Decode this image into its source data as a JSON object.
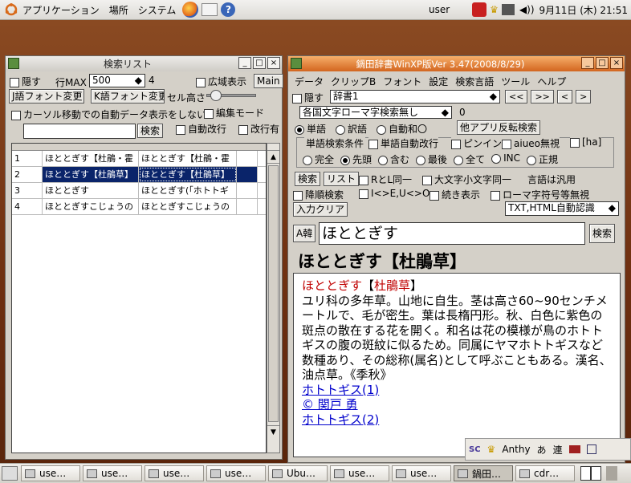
{
  "top_panel": {
    "menus": [
      "アプリケーション",
      "場所",
      "システム"
    ],
    "user": "user",
    "datetime": "9月11日 (木) 21:51"
  },
  "search_list": {
    "title": "検索リスト",
    "hide_label": "隠す",
    "row_max_label": "行MAX",
    "row_max_value": "500",
    "count": "4",
    "wide_display_label": "広域表示",
    "main_button": "Main",
    "font_btn1": "J語フォント変更",
    "font_btn2": "K語フォント変更",
    "cell_height_label": "セル高さ",
    "cursor_auto_label": "カーソル移動での自動データ表示をしない",
    "edit_mode_label": "編集モード",
    "search_button": "検索",
    "auto_newline_label": "自動改行",
    "newline_label": "改行有",
    "rows": [
      {
        "num": "1",
        "c1": "ほととぎす【杜鵑・霍",
        "c2": "ほととぎす【杜鵑・霍"
      },
      {
        "num": "2",
        "c1": "ほととぎす【杜鵑草】",
        "c2": "ほととぎす【杜鵑草】"
      },
      {
        "num": "3",
        "c1": "ほととぎす",
        "c2": "ほととぎす(「ホトトギ"
      },
      {
        "num": "4",
        "c1": "ほととぎすこじょうの",
        "c2": "ほととぎすこじょうの"
      }
    ]
  },
  "main_window": {
    "title": "鍋田辞書WinXP版Ver 3.47(2008/8/29)",
    "menu": [
      "データ",
      "クリップB",
      "フォント",
      "設定",
      "検索言語",
      "ツール",
      "ヘルプ"
    ],
    "hide_label": "隠す",
    "dict_value": "辞書1",
    "nav_buttons": [
      "<<",
      ">>",
      "<",
      ">"
    ],
    "romaji_select": "各国文字ローマ字検索無し",
    "romaji_count": "0",
    "mode_radios": [
      "単語",
      "訳語",
      "自動和〇"
    ],
    "other_app_button": "他アプリ反転検索",
    "word_cond_label": "単語検索条件",
    "word_auto_newline": "単語自動改行",
    "pinyin_label": "ピンイン",
    "aiueo_label": "aiueo無視",
    "ha_label": "[ha]",
    "match_radios": [
      "完全",
      "先頭",
      "含む",
      "最後",
      "全て",
      "INC",
      "正規"
    ],
    "search_button": "検索",
    "list_button": "リスト",
    "rl_label": "RとL同一",
    "case_label": "大文字小文字同一",
    "lang_label": "言語は汎用",
    "desc_label": "降順検索",
    "ie_label": "I<>E,U<>O",
    "cont_label": "続き表示",
    "roman_label": "ローマ字符号等無視",
    "clear_button": "入力クリア",
    "auto_recog": "TXT,HTML自動認識",
    "lang_toggle": "A韓",
    "query": "ほととぎす",
    "query_search_button": "検索",
    "headword": "ほととぎす【杜鵑草】",
    "def_word": "ほととぎす",
    "def_kanji": "杜鵑草",
    "definition": "ユリ科の多年草。山地に自生。茎は高さ60~90センチメートルで、毛が密生。葉は長楕円形。秋、白色に紫色の斑点の散在する花を開く。和名は花の模様が鳥のホトトギスの腹の斑紋に似るため。同属にヤマホトトギスなど数種あり、その総称(属名)として呼ぶこともある。漢名、油点草。《季秋》",
    "links": [
      "ホトトギス(1)",
      "© 関戸 勇",
      "ホトトギス(2)"
    ]
  },
  "ime_bar": {
    "name": "Anthy",
    "mode": "あ",
    "conv": "連"
  },
  "taskbar": [
    "use…",
    "use…",
    "use…",
    "use…",
    "Ubu…",
    "use…",
    "use…",
    "鍋田…",
    "cdr…"
  ],
  "colors": {
    "title_active": "#e07a2e",
    "headword_red": "#c00000",
    "selection": "#0a246a"
  }
}
